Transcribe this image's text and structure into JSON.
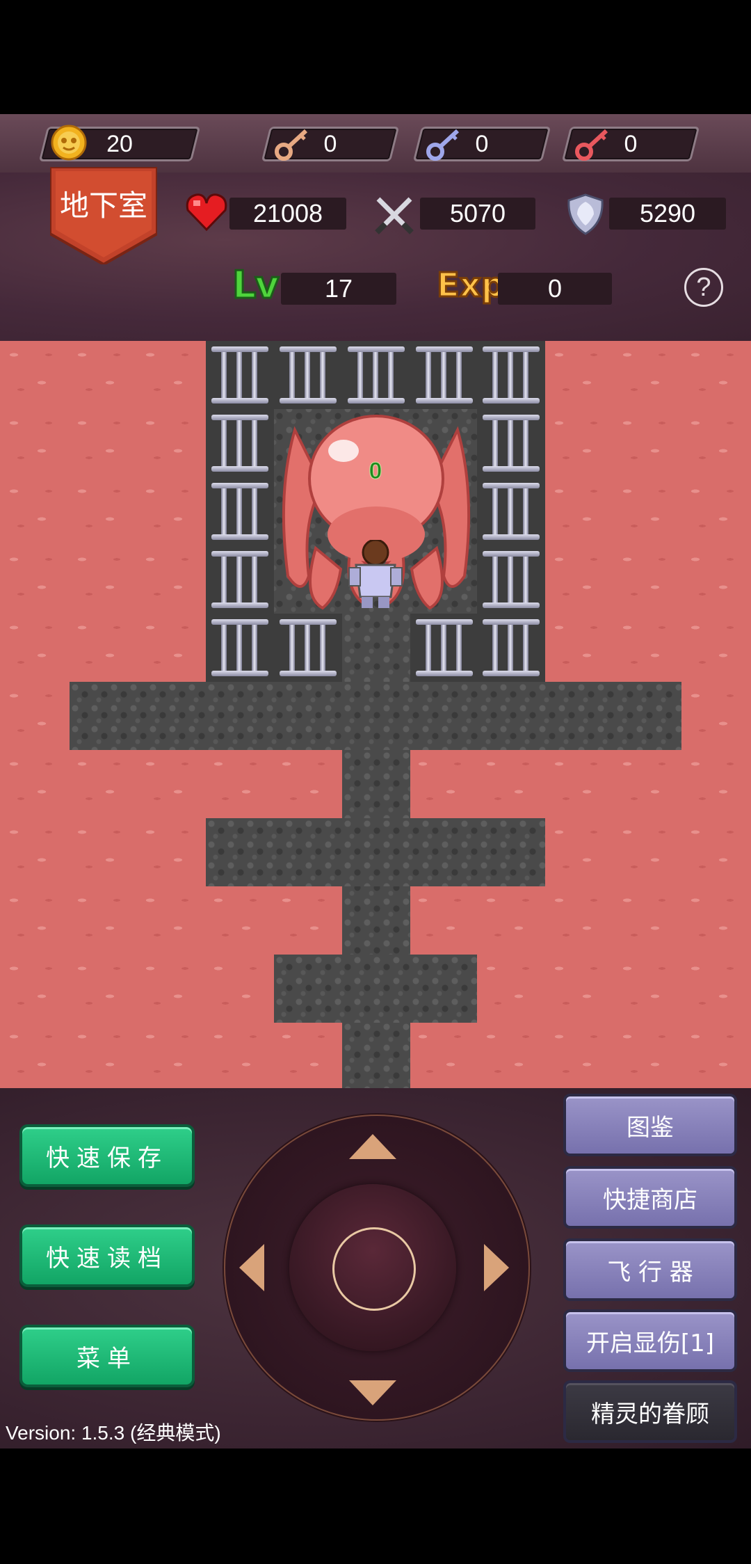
{
  "resources": {
    "coins": "20",
    "yellow_keys": "0",
    "blue_keys": "0",
    "red_keys": "0"
  },
  "floor": {
    "name": "地下室"
  },
  "stats": {
    "hp": "21008",
    "attack": "5070",
    "defense": "5290",
    "level_label": "Lv",
    "level": "17",
    "exp_label": "Exp",
    "exp": "0",
    "help": "?"
  },
  "map": {
    "monster": "red-octopus-boss",
    "damage_display": "0",
    "hero": "armored-hero"
  },
  "buttons": {
    "quick_save": "快速保存",
    "quick_load": "快速读档",
    "menu": "菜单",
    "compendium": "图鉴",
    "quick_shop": "快捷商店",
    "flyer": "飞 行 器",
    "show_damage": "开启显伤[1]",
    "fairy_favor": "精灵的眷顾"
  },
  "version": "Version: 1.5.3 (经典模式)",
  "colors": {
    "lava": "#d96d6a",
    "stone": "#4a4a4a",
    "green_button": "#12a565",
    "purple_button": "#7771ad"
  }
}
